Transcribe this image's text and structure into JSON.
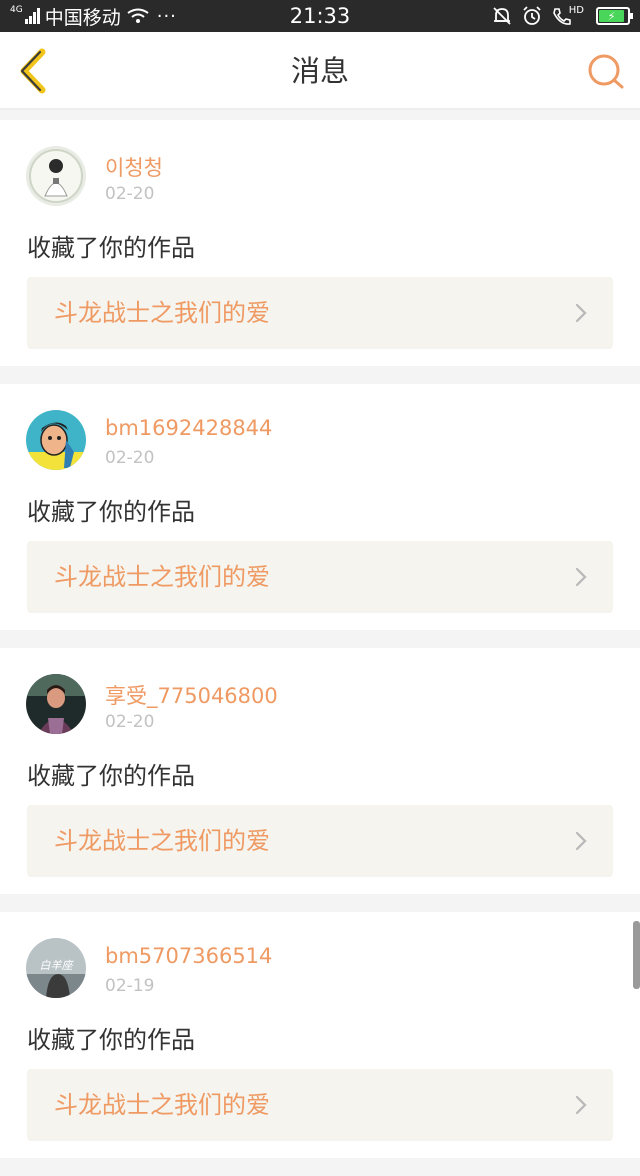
{
  "status_bar": {
    "network": "4G",
    "carrier": "中国移动",
    "dots": "···",
    "time": "21:33",
    "hd": "HD",
    "battery_level": 0.9
  },
  "header": {
    "title": "消息",
    "back_icon": "chevron-left-icon",
    "search_icon": "search-icon"
  },
  "colors": {
    "accent": "#ef9a63",
    "back_arrow": "#f0c419",
    "card_link_bg": "#f5f4ef"
  },
  "messages": [
    {
      "username": "이청청",
      "date": "02-20",
      "action": "收藏了你的作品",
      "work_title": "斗龙战士之我们的爱"
    },
    {
      "username": "bm1692428844",
      "date": "02-20",
      "action": "收藏了你的作品",
      "work_title": "斗龙战士之我们的爱"
    },
    {
      "username": "享受_775046800",
      "date": "02-20",
      "action": "收藏了你的作品",
      "work_title": "斗龙战士之我们的爱"
    },
    {
      "username": "bm5707366514",
      "date": "02-19",
      "action": "收藏了你的作品",
      "work_title": "斗龙战士之我们的爱"
    }
  ],
  "avatar_texts": [
    "白羊座"
  ]
}
